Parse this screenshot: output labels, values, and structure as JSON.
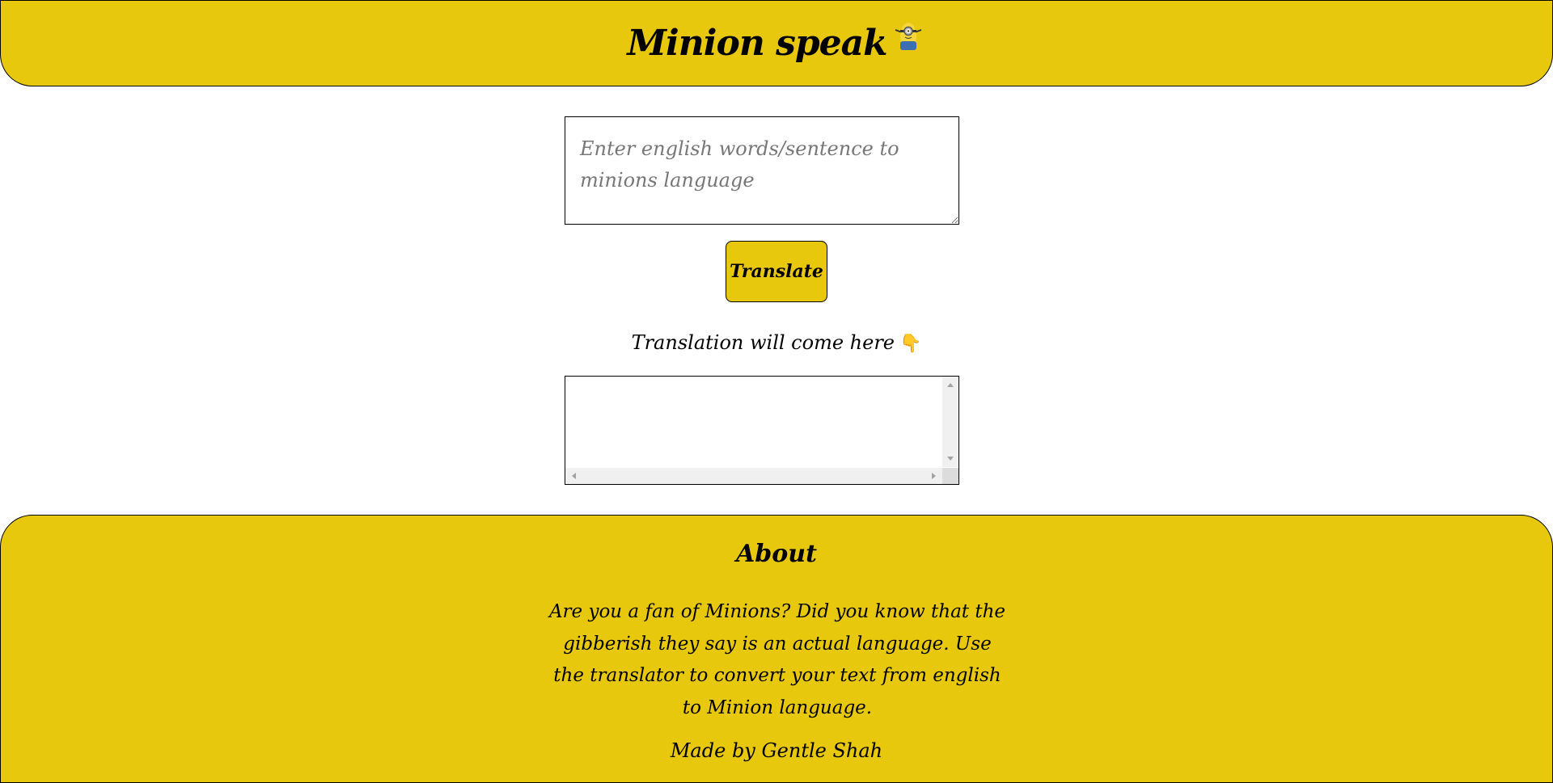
{
  "header": {
    "title": "Minion speak",
    "icon": "minion-icon",
    "background": "#e8c80c"
  },
  "input": {
    "placeholder": "Enter english words/sentence to minions language",
    "value": ""
  },
  "translate_button": {
    "label": "Translate",
    "background": "#e8c80c"
  },
  "output": {
    "label": "Translation will come here",
    "pointer_icon": "👇",
    "value": ""
  },
  "footer": {
    "heading": "About",
    "about_text": "Are you a fan of Minions? Did you know that the gibberish they say is an actual language. Use the translator to convert your text from english to Minion language.",
    "credit": "Made by Gentle Shah"
  }
}
